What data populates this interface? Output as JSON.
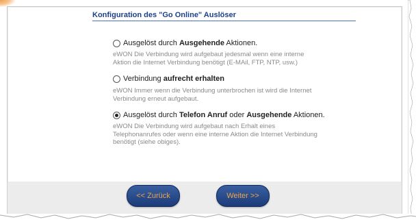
{
  "section": {
    "title": "Konfiguration des \"Go Online\" Auslöser"
  },
  "options": [
    {
      "prefix": "Ausgelöst durch ",
      "bold": "Ausgehende",
      "suffix": " Aktionen.",
      "checked": false,
      "description_lines": [
        "eWON Die Verbindung wird aufgebaut jedesmal wenn eine interne",
        "Aktion die Internet Verbindung benötigt (E-MAil, FTP, NTP, usw.)"
      ]
    },
    {
      "prefix": "Verbindung ",
      "bold": "aufrecht erhalten",
      "suffix": "",
      "checked": false,
      "description_lines": [
        "eWON Immer wenn die Verbindung unterbrochen ist wird die Internet",
        "Verbindung erneut aufgebaut."
      ]
    },
    {
      "prefix": "Ausgelöst durch ",
      "bold": "Telefon Anruf",
      "middle": " oder ",
      "bold2": "Ausgehende",
      "suffix": " Aktionen.",
      "checked": true,
      "description_lines": [
        "eWON Die Verbindung wird aufgebaut nach Erhalt eines",
        "Telephonanrufes oder wenn eine interne Aktion die Internet Verbindung",
        "benötigt (siehe obiges)."
      ]
    }
  ],
  "nav": {
    "back_label": "<< Zurück",
    "next_label": "Weiter >>"
  },
  "colors": {
    "title": "#1c3f8c",
    "button_bg": "#1c3b79",
    "button_text": "#f0a44a",
    "description": "#8a8a8a"
  }
}
